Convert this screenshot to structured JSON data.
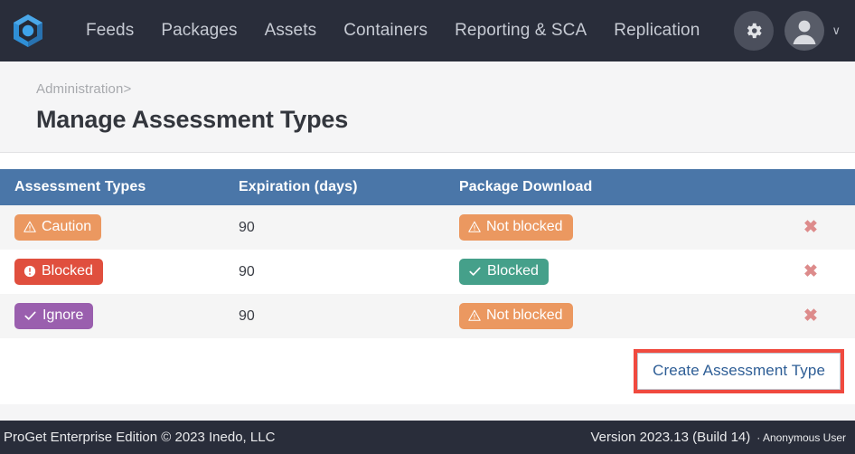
{
  "app": {
    "logo_icon": "proget-cube-logo-icon",
    "brand_color": "#3aa0e8"
  },
  "nav": {
    "items": [
      {
        "label": "Feeds"
      },
      {
        "label": "Packages"
      },
      {
        "label": "Assets"
      },
      {
        "label": "Containers"
      },
      {
        "label": "Reporting & SCA"
      },
      {
        "label": "Replication"
      }
    ],
    "settings_icon": "gear-icon",
    "user_icon": "user-avatar-icon",
    "user_caret": "∨"
  },
  "page": {
    "breadcrumb_parent": "Administration",
    "breadcrumb_separator": ">",
    "title": "Manage Assessment Types"
  },
  "table": {
    "columns": [
      "Assessment Types",
      "Expiration (days)",
      "Package Download",
      ""
    ],
    "rows": [
      {
        "type_label": "Caution",
        "type_icon": "warning-triangle-icon",
        "type_color": "#eb9860",
        "expiration": "90",
        "download_label": "Not blocked",
        "download_icon": "warning-triangle-icon",
        "download_color": "#eb9860",
        "delete_icon": "close-x-icon",
        "delete_glyph": "✖"
      },
      {
        "type_label": "Blocked",
        "type_icon": "exclamation-circle-icon",
        "type_color": "#e04f3e",
        "expiration": "90",
        "download_label": "Blocked",
        "download_icon": "check-icon",
        "download_color": "#45a08a",
        "delete_icon": "close-x-icon",
        "delete_glyph": "✖"
      },
      {
        "type_label": "Ignore",
        "type_icon": "check-icon",
        "type_color": "#9a5fae",
        "expiration": "90",
        "download_label": "Not blocked",
        "download_icon": "warning-triangle-icon",
        "download_color": "#eb9860",
        "delete_icon": "close-x-icon",
        "delete_glyph": "✖"
      }
    ]
  },
  "actions": {
    "create_label": "Create Assessment Type",
    "highlight_color": "#f04a3f"
  },
  "footer": {
    "left_text": "ProGet Enterprise Edition © 2023 Inedo, LLC",
    "version": "Version 2023.13 (Build 14)",
    "user": "· Anonymous User"
  }
}
